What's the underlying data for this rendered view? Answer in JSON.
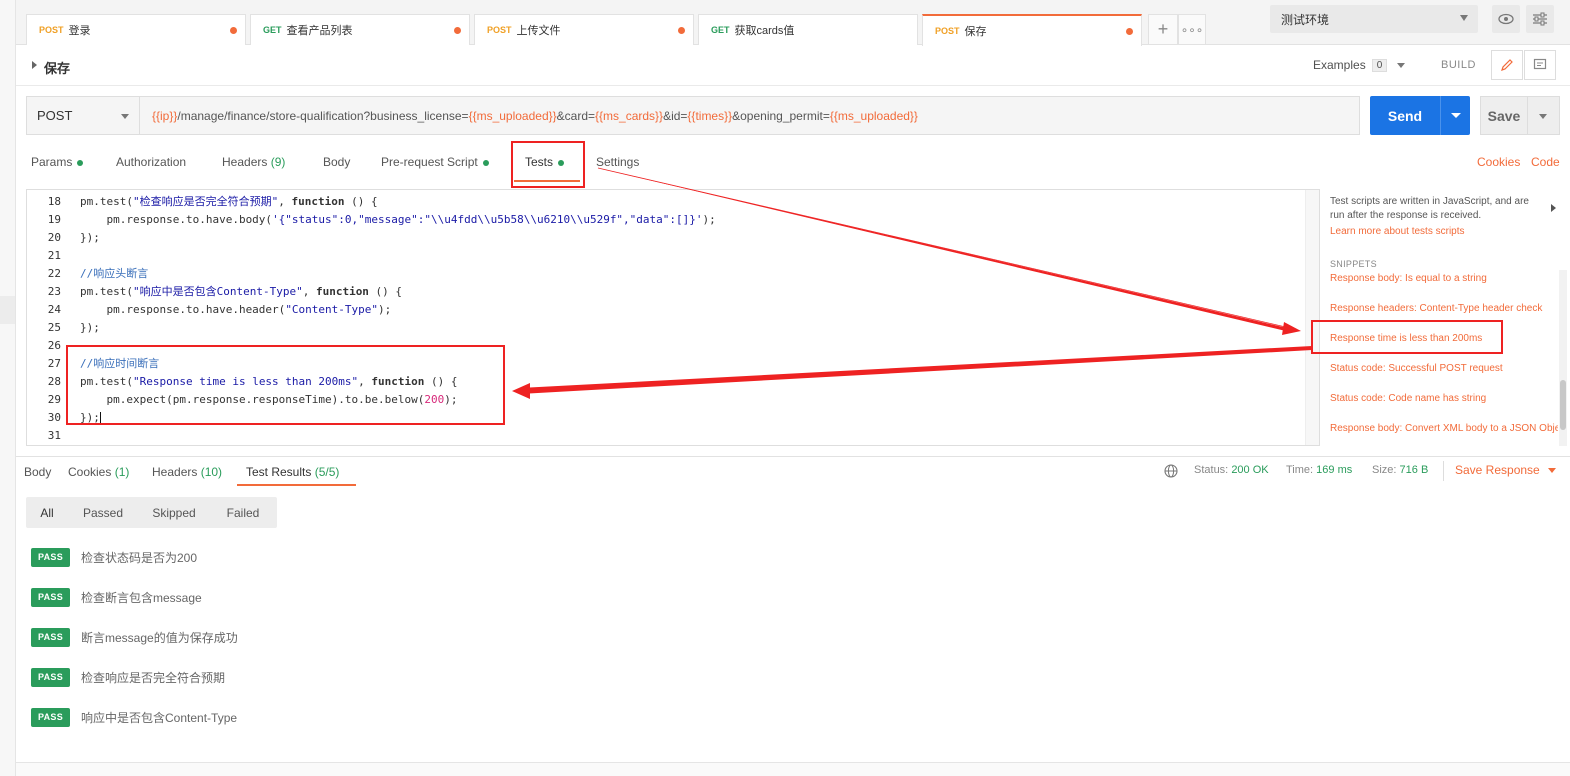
{
  "tabs": [
    {
      "method": "POST",
      "name": "登录",
      "unsaved": true,
      "active": false
    },
    {
      "method": "GET",
      "name": "查看产品列表",
      "unsaved": true,
      "active": false
    },
    {
      "method": "POST",
      "name": "上传文件",
      "unsaved": true,
      "active": false
    },
    {
      "method": "GET",
      "name": "获取cards值",
      "unsaved": false,
      "active": false
    },
    {
      "method": "POST",
      "name": "保存",
      "unsaved": true,
      "active": true
    }
  ],
  "tabs_extra": {
    "add": "+",
    "more": "∘∘∘"
  },
  "environment": {
    "selected": "测试环境"
  },
  "request": {
    "name": "保存",
    "examples_label": "Examples",
    "examples_count": "0",
    "build_label": "BUILD",
    "method": "POST",
    "url": {
      "v1": "{{ip}}",
      "t1": "/manage/finance/store-qualification?business_license=",
      "v2": "{{ms_uploaded}}",
      "t2": "&card=",
      "v3": "{{ms_cards}}",
      "t3": "&id=",
      "v4": "{{times}}",
      "t4": "&opening_permit=",
      "v5": "{{ms_uploaded}}"
    },
    "send_label": "Send",
    "save_label": "Save"
  },
  "sub_tabs": {
    "params": "Params",
    "authorization": "Authorization",
    "headers": "Headers",
    "headers_count": "(9)",
    "body": "Body",
    "prerequest": "Pre-request Script",
    "tests": "Tests",
    "settings": "Settings",
    "cookies": "Cookies",
    "code": "Code"
  },
  "editor": {
    "lines": [
      {
        "n": "18"
      },
      {
        "n": "19"
      },
      {
        "n": "20"
      },
      {
        "n": "21"
      },
      {
        "n": "22"
      },
      {
        "n": "23"
      },
      {
        "n": "24"
      },
      {
        "n": "25"
      },
      {
        "n": "26"
      },
      {
        "n": "27"
      },
      {
        "n": "28"
      },
      {
        "n": "29"
      },
      {
        "n": "30"
      },
      {
        "n": "31"
      }
    ],
    "l18": {
      "a": "pm.test(",
      "s": "\"检查响应是否完全符合预期\"",
      "b": ", ",
      "k": "function",
      "c": " () {"
    },
    "l19": {
      "a": "    pm.response.to.have.body(",
      "s": "'{\"status\":0,\"message\":\"\\\\u4fdd\\\\u5b58\\\\u6210\\\\u529f\",\"data\":[]}'",
      "b": ");"
    },
    "l20": "});",
    "l22": "//响应头断言",
    "l23": {
      "a": "pm.test(",
      "s": "\"响应中是否包含Content-Type\"",
      "b": ", ",
      "k": "function",
      "c": " () {"
    },
    "l24": {
      "a": "    pm.response.to.have.header(",
      "s": "\"Content-Type\"",
      "b": ");"
    },
    "l25": "});",
    "l27": "//响应时间断言",
    "l28": {
      "a": "pm.test(",
      "s": "\"Response time is less than 200ms\"",
      "b": ", ",
      "k": "function",
      "c": " () {"
    },
    "l29": {
      "a": "    pm.expect(pm.response.responseTime).to.be.below(",
      "num": "200",
      "b": ");"
    },
    "l30": "});"
  },
  "snippets": {
    "description": "Test scripts are written in JavaScript, and are run after the response is received.",
    "learn_more": "Learn more about tests scripts",
    "heading": "SNIPPETS",
    "items": [
      "Response body: Is equal to a string",
      "Response headers: Content-Type header check",
      "Response time is less than 200ms",
      "Status code: Successful POST request",
      "Status code: Code name has string",
      "Response body: Convert XML body to a JSON Object"
    ]
  },
  "response": {
    "tabs": {
      "body": "Body",
      "cookies": "Cookies",
      "cookies_count": "(1)",
      "headers": "Headers",
      "headers_count": "(10)",
      "test_results": "Test Results",
      "test_results_count": "(5/5)"
    },
    "status_label": "Status:",
    "status_value": "200 OK",
    "time_label": "Time:",
    "time_value": "169 ms",
    "size_label": "Size:",
    "size_value": "716 B",
    "save_response": "Save Response",
    "filters": [
      "All",
      "Passed",
      "Skipped",
      "Failed"
    ],
    "results": [
      {
        "badge": "PASS",
        "text": "检查状态码是否为200"
      },
      {
        "badge": "PASS",
        "text": "检查断言包含message"
      },
      {
        "badge": "PASS",
        "text": "断言message的值为保存成功"
      },
      {
        "badge": "PASS",
        "text": "检查响应是否完全符合预期"
      },
      {
        "badge": "PASS",
        "text": "响应中是否包含Content-Type"
      }
    ]
  },
  "colors": {
    "accent": "#f26b3a",
    "send": "#1b74e4",
    "pass": "#2a9c5b",
    "annotation": "#ee2222"
  }
}
